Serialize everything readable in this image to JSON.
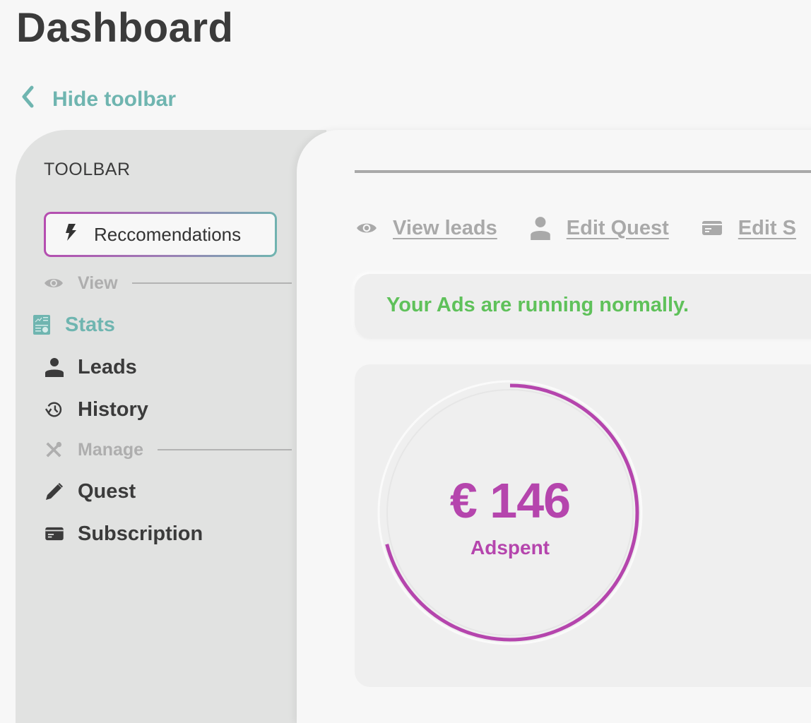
{
  "page": {
    "title": "Dashboard"
  },
  "hide_toolbar": {
    "label": "Hide toolbar",
    "icon": "chevron-left-icon"
  },
  "sidebar": {
    "title": "TOOLBAR",
    "recommendations": {
      "label": "Reccomendations",
      "icon": "lightning-icon"
    },
    "sections": [
      {
        "label": "View",
        "icon": "eye-icon"
      },
      {
        "label": "Manage",
        "icon": "tools-icon"
      }
    ],
    "items": [
      {
        "label": "Stats",
        "icon": "stats-report-icon",
        "active": true
      },
      {
        "label": "Leads",
        "icon": "person-icon",
        "active": false
      },
      {
        "label": "History",
        "icon": "history-icon",
        "active": false
      },
      {
        "label": "Quest",
        "icon": "pencil-icon",
        "active": false
      },
      {
        "label": "Subscription",
        "icon": "credit-card-icon",
        "active": false
      }
    ]
  },
  "main": {
    "quick_links": [
      {
        "label": "View leads",
        "icon": "eye-icon"
      },
      {
        "label": "Edit Quest",
        "icon": "person-icon"
      },
      {
        "label": "Edit S",
        "icon": "credit-card-icon"
      }
    ],
    "status": {
      "text": "Your Ads are running normally."
    },
    "adspent": {
      "value": "€ 146",
      "label": "Adspent",
      "progress_fraction": 0.71
    }
  },
  "colors": {
    "accent_teal": "#6fb5b0",
    "accent_magenta": "#b545ad",
    "status_green": "#5fc15a",
    "text_dark": "#3b3b3b",
    "text_muted": "#a9a9a9"
  }
}
